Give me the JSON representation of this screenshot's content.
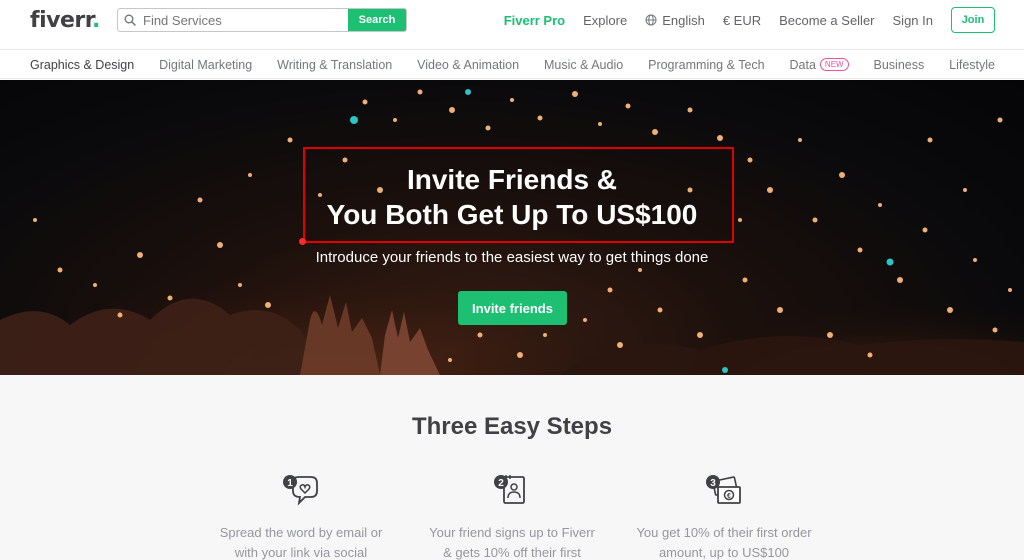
{
  "header": {
    "logo": "fiverr",
    "logo_dot": ".",
    "search_placeholder": "Find Services",
    "search_button": "Search",
    "nav": {
      "pro": "Fiverr Pro",
      "explore": "Explore",
      "language": "English",
      "currency": "€ EUR",
      "become_seller": "Become a Seller",
      "sign_in": "Sign In",
      "join": "Join"
    }
  },
  "categories": [
    {
      "label": "Graphics & Design"
    },
    {
      "label": "Digital Marketing"
    },
    {
      "label": "Writing & Translation"
    },
    {
      "label": "Video & Animation"
    },
    {
      "label": "Music & Audio"
    },
    {
      "label": "Programming & Tech"
    },
    {
      "label": "Data",
      "badge": "NEW"
    },
    {
      "label": "Business"
    },
    {
      "label": "Lifestyle"
    }
  ],
  "hero": {
    "title_line1": "Invite Friends &",
    "title_line2": "You Both Get Up To US$100",
    "subtitle": "Introduce your friends to the easiest way to get things done",
    "cta": "Invite friends"
  },
  "steps": {
    "title": "Three Easy Steps",
    "items": [
      {
        "number": "1",
        "icon": "chat-heart-icon",
        "line1": "Spread the word by email or",
        "line2": "with your link via social"
      },
      {
        "number": "2",
        "icon": "contact-card-icon",
        "line1": "Your friend signs up to Fiverr",
        "line2": "& gets 10% off their first"
      },
      {
        "number": "3",
        "icon": "money-icon",
        "line1": "You get 10% of their first order",
        "line2": "amount, up to US$100"
      }
    ]
  },
  "colors": {
    "brand_green": "#1dbf73",
    "annotation_red": "#e00000",
    "new_badge": "#e5529f"
  }
}
